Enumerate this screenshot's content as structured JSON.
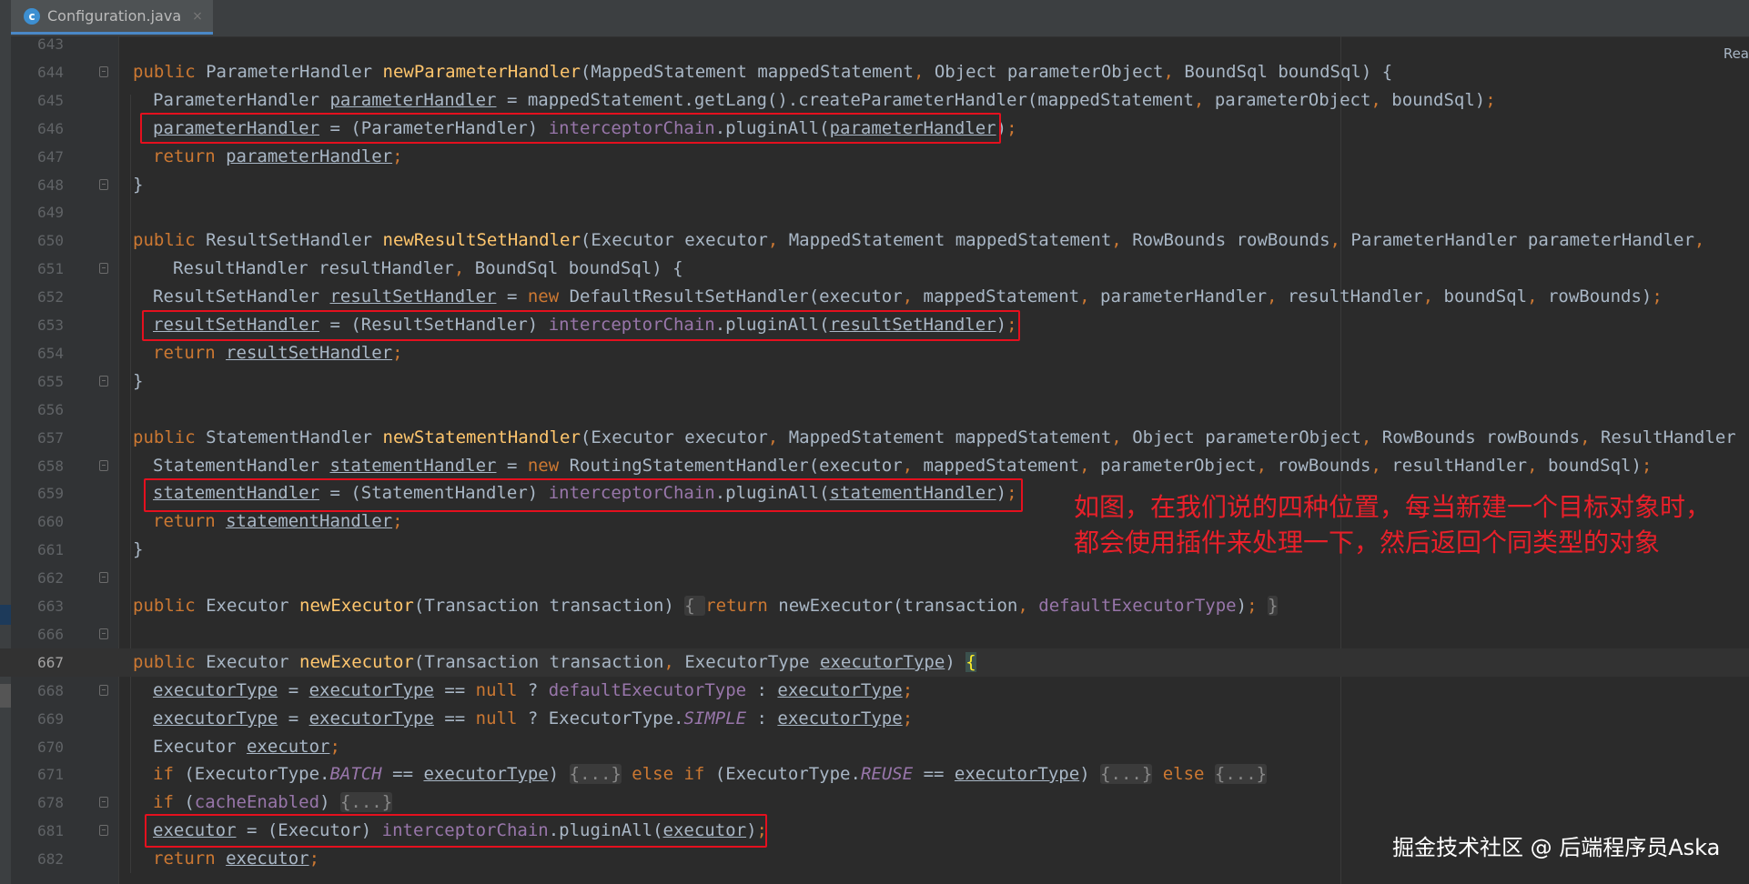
{
  "tab": {
    "filename": "Configuration.java",
    "close": "×",
    "icon_letter": "c"
  },
  "readmode": "Rea",
  "lines": [
    {
      "num": "643",
      "tokens": []
    },
    {
      "num": "644",
      "tokens": [
        {
          "t": "public ",
          "c": "kw"
        },
        {
          "t": "ParameterHandler "
        },
        {
          "t": "newParameterHandler",
          "c": "fn"
        },
        {
          "t": "(MappedStatement mappedStatement"
        },
        {
          "t": ", ",
          "c": "kw"
        },
        {
          "t": "Object parameterObject"
        },
        {
          "t": ", ",
          "c": "kw"
        },
        {
          "t": "BoundSql boundSql) {"
        }
      ]
    },
    {
      "num": "645",
      "tokens": [
        {
          "t": "ParameterHandler "
        },
        {
          "t": "parameterHandler",
          "c": "ul"
        },
        {
          "t": " = mappedStatement.getLang().createParameterHandler(mappedStatement"
        },
        {
          "t": ", ",
          "c": "kw"
        },
        {
          "t": "parameterObject"
        },
        {
          "t": ", ",
          "c": "kw"
        },
        {
          "t": "boundSql)"
        },
        {
          "t": ";",
          "c": "kw"
        }
      ]
    },
    {
      "num": "646",
      "tokens": [
        {
          "t": "parameterHandler",
          "c": "ul"
        },
        {
          "t": " = (ParameterHandler) "
        },
        {
          "t": "interceptorChain",
          "c": "fd"
        },
        {
          "t": ".pluginAll("
        },
        {
          "t": "parameterHandler",
          "c": "ul"
        },
        {
          "t": ")"
        },
        {
          "t": ";",
          "c": "kw"
        }
      ]
    },
    {
      "num": "647",
      "tokens": [
        {
          "t": "return ",
          "c": "kw"
        },
        {
          "t": "parameterHandler",
          "c": "ul"
        },
        {
          "t": ";",
          "c": "kw"
        }
      ]
    },
    {
      "num": "648",
      "tokens": [
        {
          "t": "}"
        }
      ]
    },
    {
      "num": "649",
      "tokens": []
    },
    {
      "num": "650",
      "tokens": [
        {
          "t": "public ",
          "c": "kw"
        },
        {
          "t": "ResultSetHandler "
        },
        {
          "t": "newResultSetHandler",
          "c": "fn"
        },
        {
          "t": "(Executor executor"
        },
        {
          "t": ", ",
          "c": "kw"
        },
        {
          "t": "MappedStatement mappedStatement"
        },
        {
          "t": ", ",
          "c": "kw"
        },
        {
          "t": "RowBounds rowBounds"
        },
        {
          "t": ", ",
          "c": "kw"
        },
        {
          "t": "ParameterHandler parameterHandler"
        },
        {
          "t": ",",
          "c": "kw"
        }
      ]
    },
    {
      "num": "651",
      "tokens": [
        {
          "t": "ResultHandler resultHandler"
        },
        {
          "t": ", ",
          "c": "kw"
        },
        {
          "t": "BoundSql boundSql) {"
        }
      ]
    },
    {
      "num": "652",
      "tokens": [
        {
          "t": "ResultSetHandler "
        },
        {
          "t": "resultSetHandler",
          "c": "ul"
        },
        {
          "t": " = "
        },
        {
          "t": "new ",
          "c": "kw"
        },
        {
          "t": "DefaultResultSetHandler(executor"
        },
        {
          "t": ", ",
          "c": "kw"
        },
        {
          "t": "mappedStatement"
        },
        {
          "t": ", ",
          "c": "kw"
        },
        {
          "t": "parameterHandler"
        },
        {
          "t": ", ",
          "c": "kw"
        },
        {
          "t": "resultHandler"
        },
        {
          "t": ", ",
          "c": "kw"
        },
        {
          "t": "boundSql"
        },
        {
          "t": ", ",
          "c": "kw"
        },
        {
          "t": "rowBounds)"
        },
        {
          "t": ";",
          "c": "kw"
        }
      ]
    },
    {
      "num": "653",
      "tokens": [
        {
          "t": "resultSetHandler",
          "c": "ul"
        },
        {
          "t": " = (ResultSetHandler) "
        },
        {
          "t": "interceptorChain",
          "c": "fd"
        },
        {
          "t": ".pluginAll("
        },
        {
          "t": "resultSetHandler",
          "c": "ul"
        },
        {
          "t": ")"
        },
        {
          "t": ";",
          "c": "kw"
        }
      ]
    },
    {
      "num": "654",
      "tokens": [
        {
          "t": "return ",
          "c": "kw"
        },
        {
          "t": "resultSetHandler",
          "c": "ul"
        },
        {
          "t": ";",
          "c": "kw"
        }
      ]
    },
    {
      "num": "655",
      "tokens": [
        {
          "t": "}"
        }
      ]
    },
    {
      "num": "656",
      "tokens": []
    },
    {
      "num": "657",
      "tokens": [
        {
          "t": "public ",
          "c": "kw"
        },
        {
          "t": "StatementHandler "
        },
        {
          "t": "newStatementHandler",
          "c": "fn"
        },
        {
          "t": "(Executor executor"
        },
        {
          "t": ", ",
          "c": "kw"
        },
        {
          "t": "MappedStatement mappedStatement"
        },
        {
          "t": ", ",
          "c": "kw"
        },
        {
          "t": "Object parameterObject"
        },
        {
          "t": ", ",
          "c": "kw"
        },
        {
          "t": "RowBounds rowBounds"
        },
        {
          "t": ", ",
          "c": "kw"
        },
        {
          "t": "ResultHandler res"
        }
      ]
    },
    {
      "num": "658",
      "tokens": [
        {
          "t": "StatementHandler "
        },
        {
          "t": "statementHandler",
          "c": "ul"
        },
        {
          "t": " = "
        },
        {
          "t": "new ",
          "c": "kw"
        },
        {
          "t": "RoutingStatementHandler(executor"
        },
        {
          "t": ", ",
          "c": "kw"
        },
        {
          "t": "mappedStatement"
        },
        {
          "t": ", ",
          "c": "kw"
        },
        {
          "t": "parameterObject"
        },
        {
          "t": ", ",
          "c": "kw"
        },
        {
          "t": "rowBounds"
        },
        {
          "t": ", ",
          "c": "kw"
        },
        {
          "t": "resultHandler"
        },
        {
          "t": ", ",
          "c": "kw"
        },
        {
          "t": "boundSql)"
        },
        {
          "t": ";",
          "c": "kw"
        }
      ]
    },
    {
      "num": "659",
      "tokens": [
        {
          "t": "statementHandler",
          "c": "ul"
        },
        {
          "t": " = (StatementHandler) "
        },
        {
          "t": "interceptorChain",
          "c": "fd"
        },
        {
          "t": ".pluginAll("
        },
        {
          "t": "statementHandler",
          "c": "ul"
        },
        {
          "t": ")"
        },
        {
          "t": ";",
          "c": "kw"
        }
      ]
    },
    {
      "num": "660",
      "tokens": [
        {
          "t": "return ",
          "c": "kw"
        },
        {
          "t": "statementHandler",
          "c": "ul"
        },
        {
          "t": ";",
          "c": "kw"
        }
      ]
    },
    {
      "num": "661",
      "tokens": [
        {
          "t": "}"
        }
      ]
    },
    {
      "num": "662",
      "tokens": []
    },
    {
      "num": "663",
      "tokens": [
        {
          "t": "public ",
          "c": "kw"
        },
        {
          "t": "Executor "
        },
        {
          "t": "newExecutor",
          "c": "fn"
        },
        {
          "t": "(Transaction transaction) "
        },
        {
          "t": "{ ",
          "c": "fold-ph"
        },
        {
          "t": "return ",
          "c": "kw"
        },
        {
          "t": "newExecutor(transaction"
        },
        {
          "t": ", ",
          "c": "kw"
        },
        {
          "t": "defaultExecutorType",
          "c": "fd"
        },
        {
          "t": ")"
        },
        {
          "t": "; ",
          "c": "kw"
        },
        {
          "t": "}",
          "c": "fold-ph"
        }
      ]
    },
    {
      "num": "666",
      "tokens": []
    },
    {
      "num": "667",
      "current": true,
      "tokens": [
        {
          "t": "public ",
          "c": "kw"
        },
        {
          "t": "Executor "
        },
        {
          "t": "newExecutor",
          "c": "fn"
        },
        {
          "t": "(Transaction transaction"
        },
        {
          "t": ", ",
          "c": "kw"
        },
        {
          "t": "ExecutorType "
        },
        {
          "t": "executorType",
          "c": "ul"
        },
        {
          "t": ") "
        },
        {
          "t": "{",
          "c": "brace"
        }
      ]
    },
    {
      "num": "668",
      "tokens": [
        {
          "t": "executorType",
          "c": "ul"
        },
        {
          "t": " = "
        },
        {
          "t": "executorType",
          "c": "ul"
        },
        {
          "t": " == "
        },
        {
          "t": "null",
          "c": "kw"
        },
        {
          "t": " ? "
        },
        {
          "t": "defaultExecutorType",
          "c": "fd"
        },
        {
          "t": " : "
        },
        {
          "t": "executorType",
          "c": "ul"
        },
        {
          "t": ";",
          "c": "kw"
        }
      ]
    },
    {
      "num": "669",
      "tokens": [
        {
          "t": "executorType",
          "c": "ul"
        },
        {
          "t": " = "
        },
        {
          "t": "executorType",
          "c": "ul"
        },
        {
          "t": " == "
        },
        {
          "t": "null",
          "c": "kw"
        },
        {
          "t": " ? ExecutorType."
        },
        {
          "t": "SIMPLE",
          "c": "fi"
        },
        {
          "t": " : "
        },
        {
          "t": "executorType",
          "c": "ul"
        },
        {
          "t": ";",
          "c": "kw"
        }
      ]
    },
    {
      "num": "670",
      "tokens": [
        {
          "t": "Executor "
        },
        {
          "t": "executor",
          "c": "ul"
        },
        {
          "t": ";",
          "c": "kw"
        }
      ]
    },
    {
      "num": "671",
      "tokens": [
        {
          "t": "if ",
          "c": "kw"
        },
        {
          "t": "(ExecutorType."
        },
        {
          "t": "BATCH",
          "c": "fi"
        },
        {
          "t": " == "
        },
        {
          "t": "executorType",
          "c": "ul"
        },
        {
          "t": ") "
        },
        {
          "t": "{...}",
          "c": "fold-ph"
        },
        {
          "t": " else if ",
          "c": "kw"
        },
        {
          "t": "(ExecutorType."
        },
        {
          "t": "REUSE",
          "c": "fi"
        },
        {
          "t": " == "
        },
        {
          "t": "executorType",
          "c": "ul"
        },
        {
          "t": ") "
        },
        {
          "t": "{...}",
          "c": "fold-ph"
        },
        {
          "t": " else ",
          "c": "kw"
        },
        {
          "t": "{...}",
          "c": "fold-ph"
        }
      ]
    },
    {
      "num": "678",
      "tokens": [
        {
          "t": "if ",
          "c": "kw"
        },
        {
          "t": "("
        },
        {
          "t": "cacheEnabled",
          "c": "fd"
        },
        {
          "t": ") "
        },
        {
          "t": "{...}",
          "c": "fold-ph"
        }
      ]
    },
    {
      "num": "681",
      "tokens": [
        {
          "t": "executor",
          "c": "ul"
        },
        {
          "t": " = (Executor) "
        },
        {
          "t": "interceptorChain",
          "c": "fd"
        },
        {
          "t": ".pluginAll("
        },
        {
          "t": "executor",
          "c": "ul"
        },
        {
          "t": ")"
        },
        {
          "t": ";",
          "c": "kw"
        }
      ]
    },
    {
      "num": "682",
      "tokens": [
        {
          "t": "return ",
          "c": "kw"
        },
        {
          "t": "executor",
          "c": "ul"
        },
        {
          "t": ";",
          "c": "kw"
        }
      ]
    }
  ],
  "annotation": "如图，在我们说的四种位置，每当新建一个目标对象时，都会使用插件来处理一下，然后返回个同类型的对象",
  "watermark": "掘金技术社区 @ 后端程序员Aska",
  "colors": {
    "highlight_box": "#e5101e",
    "annotation_text": "#e8202a"
  }
}
